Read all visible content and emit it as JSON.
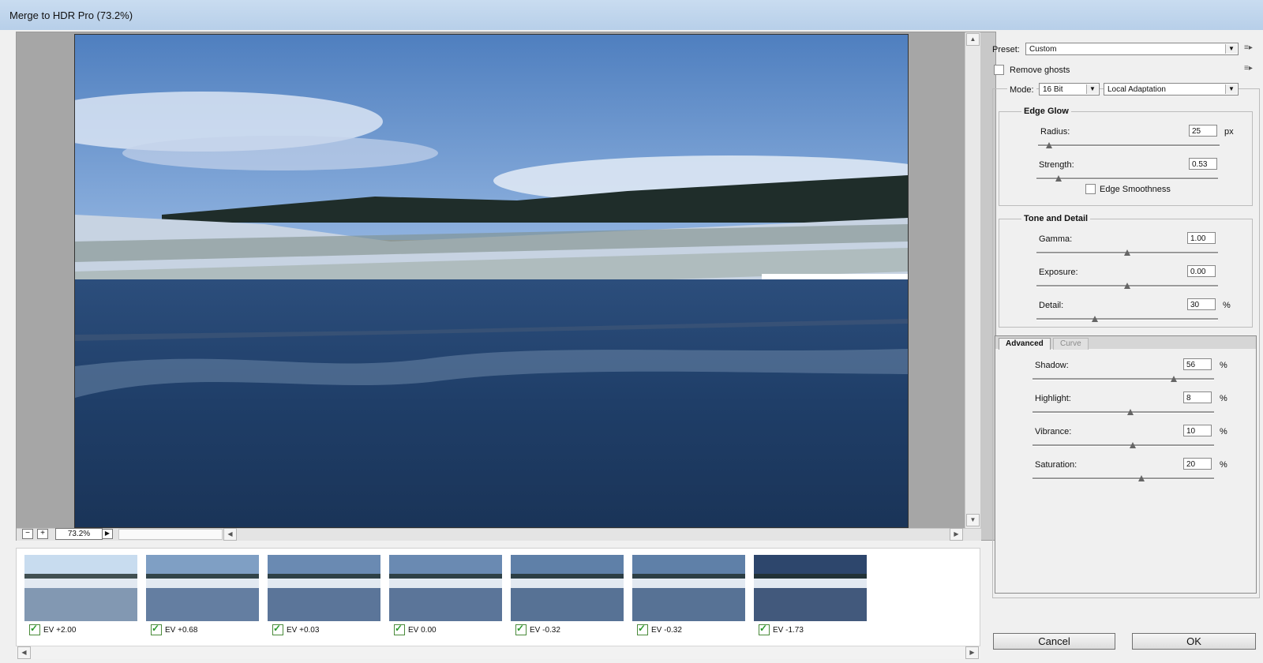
{
  "window": {
    "title": "Merge to HDR Pro (73.2%)"
  },
  "preview": {
    "zoom": "73.2%"
  },
  "filmstrip": [
    {
      "ev": "EV +2.00",
      "checked": true,
      "tone": "#c8dcef"
    },
    {
      "ev": "EV +0.68",
      "checked": true,
      "tone": "#7f9fc4"
    },
    {
      "ev": "EV +0.03",
      "checked": true,
      "tone": "#6a8ab2"
    },
    {
      "ev": "EV 0.00",
      "checked": true,
      "tone": "#6a8ab2"
    },
    {
      "ev": "EV -0.32",
      "checked": true,
      "tone": "#5f80a8"
    },
    {
      "ev": "EV -0.32",
      "checked": true,
      "tone": "#5f80a8"
    },
    {
      "ev": "EV -1.73",
      "checked": true,
      "tone": "#2d466c"
    }
  ],
  "preset": {
    "label": "Preset:",
    "value": "Custom"
  },
  "remove_ghosts": {
    "label": "Remove ghosts",
    "checked": false
  },
  "mode": {
    "label": "Mode:",
    "bit_depth": "16 Bit",
    "method": "Local Adaptation"
  },
  "edge_glow": {
    "title": "Edge Glow",
    "radius": {
      "label": "Radius:",
      "value": "25",
      "unit": "px",
      "level": 0.06
    },
    "strength": {
      "label": "Strength:",
      "value": "0.53",
      "level": 0.12
    },
    "edge_smoothness": {
      "label": "Edge Smoothness",
      "checked": false
    }
  },
  "tone_detail": {
    "title": "Tone and Detail",
    "gamma": {
      "label": "Gamma:",
      "value": "1.00",
      "level": 0.5
    },
    "exposure": {
      "label": "Exposure:",
      "value": "0.00",
      "level": 0.5
    },
    "detail": {
      "label": "Detail:",
      "value": "30",
      "unit": "%",
      "level": 0.32
    }
  },
  "tabs": [
    {
      "label": "Advanced",
      "active": true
    },
    {
      "label": "Curve",
      "active": false
    }
  ],
  "advanced": {
    "shadow": {
      "label": "Shadow:",
      "value": "56",
      "unit": "%",
      "level": 0.78
    },
    "highlight": {
      "label": "Highlight:",
      "value": "8",
      "unit": "%",
      "level": 0.54
    },
    "vibrance": {
      "label": "Vibrance:",
      "value": "10",
      "unit": "%",
      "level": 0.55
    },
    "saturation": {
      "label": "Saturation:",
      "value": "20",
      "unit": "%",
      "level": 0.6
    }
  },
  "buttons": {
    "cancel": "Cancel",
    "ok": "OK"
  }
}
